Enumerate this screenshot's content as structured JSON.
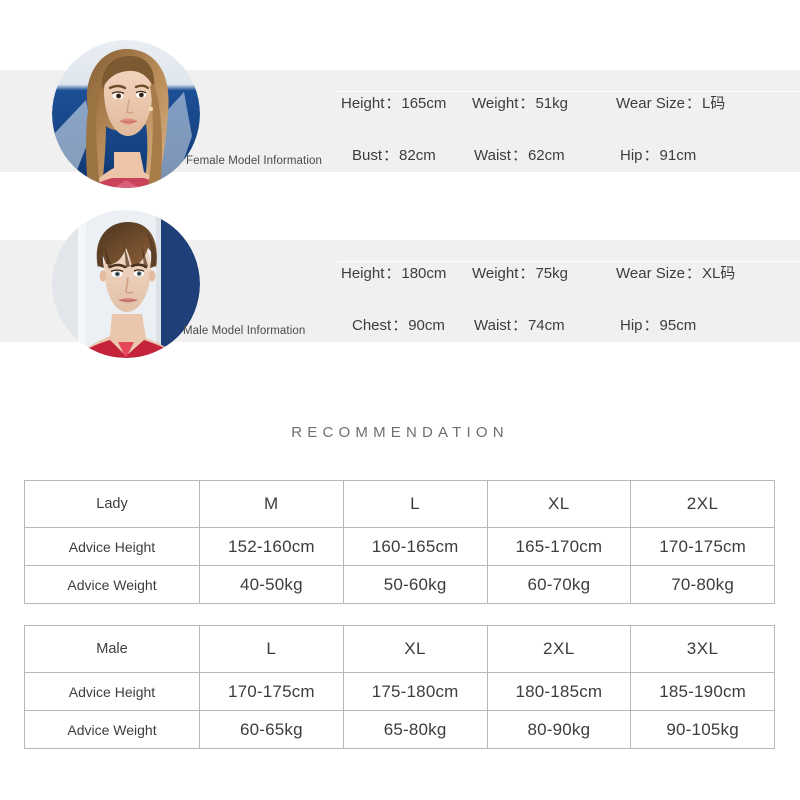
{
  "models": [
    {
      "id": "female",
      "label": "Female Model Information",
      "avatar_icon": "female-model-photo",
      "rows": [
        [
          {
            "key": "Height",
            "sep": "：",
            "value": "165cm"
          },
          {
            "key": "Weight",
            "sep": "：",
            "value": "51kg"
          },
          {
            "key": "Wear Size",
            "sep": "：",
            "value": "L码"
          }
        ],
        [
          {
            "key": "Bust",
            "sep": "：",
            "value": "82cm"
          },
          {
            "key": "Waist",
            "sep": "：",
            "value": "62cm"
          },
          {
            "key": "Hip",
            "sep": "：",
            "value": "91cm"
          }
        ]
      ]
    },
    {
      "id": "male",
      "label": "Male Model Information",
      "avatar_icon": "male-model-photo",
      "rows": [
        [
          {
            "key": "Height",
            "sep": "：",
            "value": "180cm"
          },
          {
            "key": "Weight",
            "sep": "：",
            "value": "75kg"
          },
          {
            "key": "Wear Size",
            "sep": "：",
            "value": "XL码"
          }
        ],
        [
          {
            "key": "Chest",
            "sep": "：",
            "value": "90cm"
          },
          {
            "key": "Waist",
            "sep": "：",
            "value": "74cm"
          },
          {
            "key": "Hip",
            "sep": "：",
            "value": "95cm"
          }
        ]
      ]
    }
  ],
  "recommendation": {
    "title": "RECOMMENDATION"
  },
  "chart_data": {
    "type": "table",
    "title": "RECOMMENDATION",
    "tables": [
      {
        "id": "lady",
        "header": [
          "Lady",
          "M",
          "L",
          "XL",
          "2XL"
        ],
        "rows": [
          [
            "Advice Height",
            "152-160cm",
            "160-165cm",
            "165-170cm",
            "170-175cm"
          ],
          [
            "Advice Weight",
            "40-50kg",
            "50-60kg",
            "60-70kg",
            "70-80kg"
          ]
        ]
      },
      {
        "id": "male",
        "header": [
          "Male",
          "L",
          "XL",
          "2XL",
          "3XL"
        ],
        "rows": [
          [
            "Advice Height",
            "170-175cm",
            "175-180cm",
            "180-185cm",
            "185-190cm"
          ],
          [
            "Advice Weight",
            "60-65kg",
            "65-80kg",
            "80-90kg",
            "90-105kg"
          ]
        ]
      }
    ]
  },
  "colors": {
    "band_background": "#f0f0f0",
    "page_background": "#ffffff",
    "table_border": "#b9b9b9",
    "text_primary": "#3d3d3d",
    "title_text": "#6f6f6f"
  }
}
